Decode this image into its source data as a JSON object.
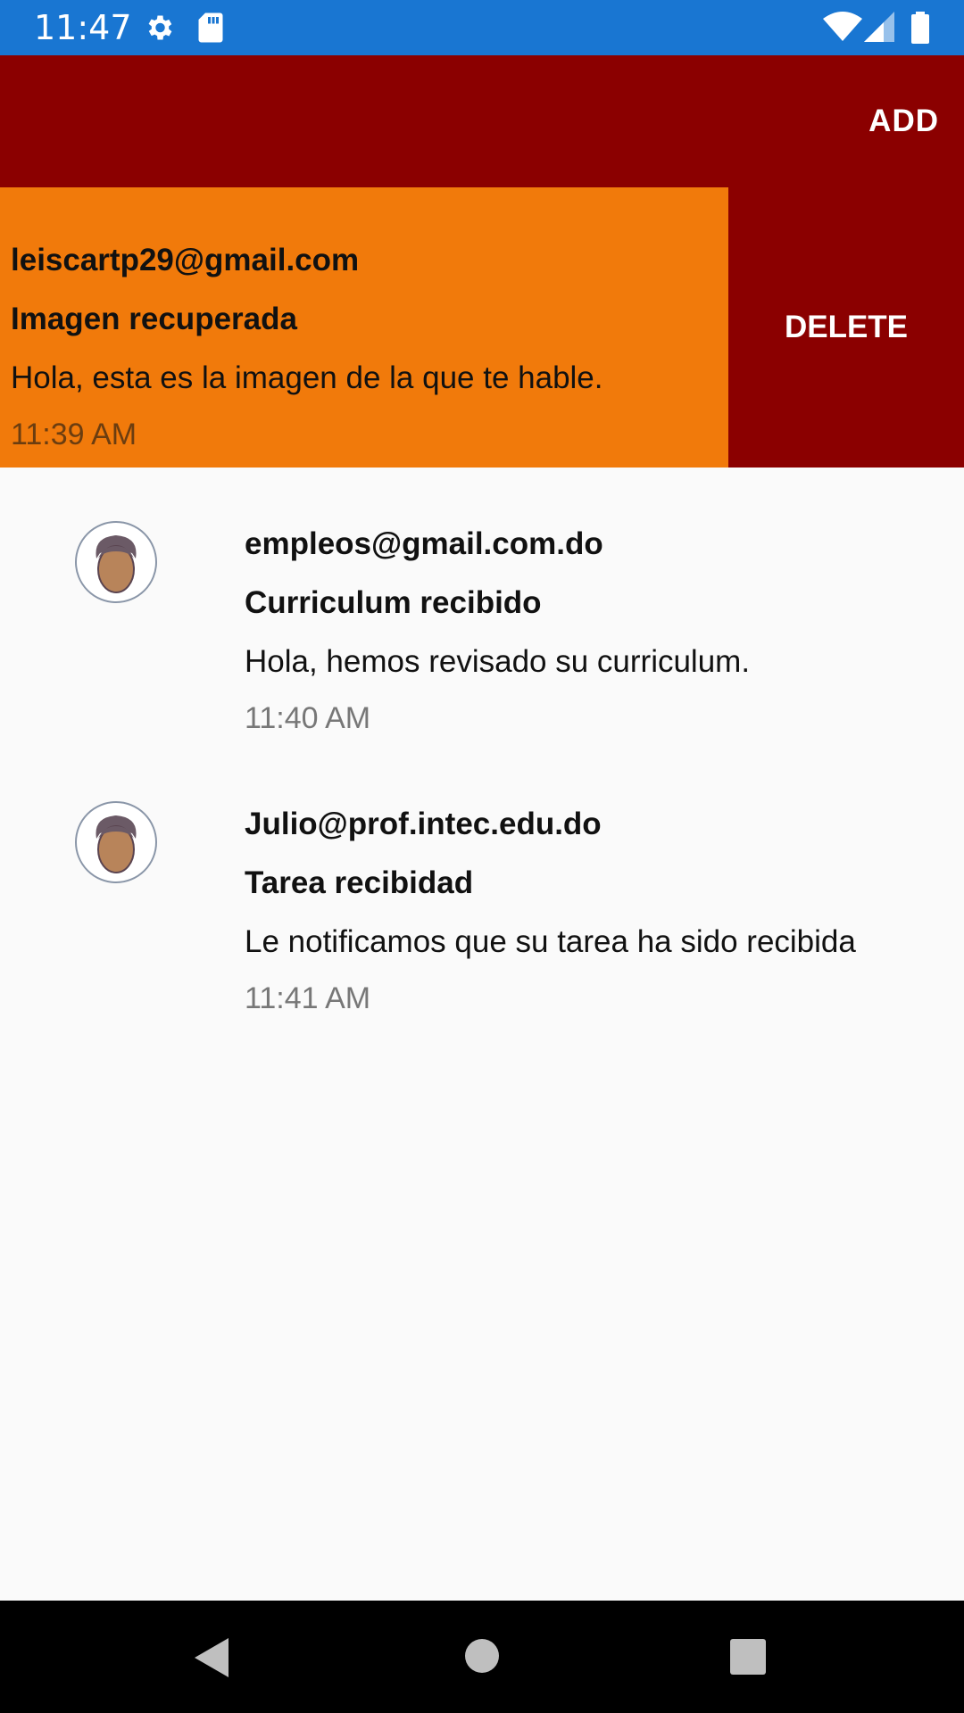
{
  "status_bar": {
    "time": "11:47",
    "icons": [
      "settings-gear-icon",
      "sd-card-icon",
      "wifi-icon",
      "signal-icon",
      "battery-icon"
    ]
  },
  "app_bar": {
    "action_label": "ADD",
    "color": "#8b0000"
  },
  "swiped_item": {
    "from": "leiscartp29@gmail.com",
    "subject": "Imagen recuperada",
    "body": "Hola, esta es la imagen de la que te hable.",
    "time": "11:39 AM",
    "delete_label": "DELETE",
    "card_color": "#f17a0b"
  },
  "messages": [
    {
      "from": "empleos@gmail.com.do",
      "subject": "Curriculum recibido",
      "body": "Hola, hemos revisado su curriculum.",
      "time": "11:40 AM"
    },
    {
      "from": "Julio@prof.intec.edu.do",
      "subject": "Tarea recibidad",
      "body": "Le notificamos que su tarea ha sido recibida",
      "time": "11:41 AM"
    }
  ],
  "nav_bar": {
    "buttons": [
      "back-icon",
      "home-icon",
      "recents-icon"
    ]
  }
}
